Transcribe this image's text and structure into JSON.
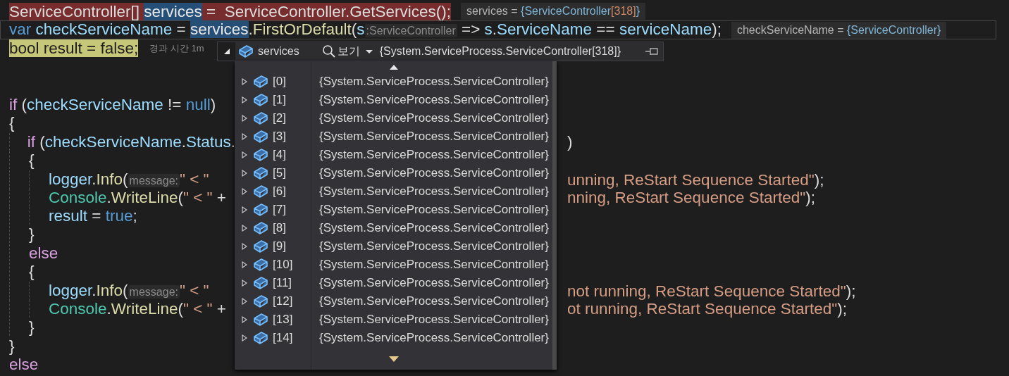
{
  "editor": {
    "lines": [
      {
        "breakpoint": true,
        "tokens": [
          {
            "text": "ServiceController[] ",
            "kind": "plain"
          },
          {
            "text": "services",
            "kind": "match"
          },
          {
            "text": " =  ServiceController.GetServices();",
            "kind": "plain"
          }
        ],
        "hint": {
          "kind": "datatip",
          "parts": [
            {
              "text": "services = ",
              "kind": "name"
            },
            {
              "text": "{ServiceController",
              "kind": "type"
            },
            {
              "text": "[318]",
              "kind": "count"
            },
            {
              "text": "}",
              "kind": "type"
            }
          ]
        }
      },
      {
        "current_line": true,
        "tokens": [
          {
            "text": "var",
            "kind": "keyword"
          },
          {
            "text": " checkServiceName",
            "kind": "variable"
          },
          {
            "text": " = ",
            "kind": "plain"
          },
          {
            "text": "services",
            "kind": "match"
          },
          {
            "text": ".",
            "kind": "plain"
          },
          {
            "text": "FirstOrDefault",
            "kind": "method"
          },
          {
            "text": "(",
            "kind": "plain"
          },
          {
            "text": "s",
            "kind": "variable"
          },
          {
            "text": ":ServiceController",
            "kind": "inlay"
          },
          {
            "text": " => ",
            "kind": "plain"
          },
          {
            "text": "s",
            "kind": "variable"
          },
          {
            "text": ".",
            "kind": "plain"
          },
          {
            "text": "ServiceName",
            "kind": "variable"
          },
          {
            "text": " == ",
            "kind": "plain"
          },
          {
            "text": "serviceName",
            "kind": "variable"
          },
          {
            "text": ");",
            "kind": "plain"
          }
        ],
        "hint": {
          "kind": "datatip",
          "parts": [
            {
              "text": "checkServiceName = ",
              "kind": "name"
            },
            {
              "text": "{ServiceController}",
              "kind": "type"
            }
          ]
        }
      },
      {
        "current_statement": true,
        "tokens": [
          {
            "text": "bool result = false;",
            "kind": "plain"
          }
        ],
        "hint": {
          "kind": "elapsed",
          "text": "경과 시간 1m"
        }
      },
      {
        "blank": true
      },
      {
        "blank": true
      },
      {
        "tokens": [
          {
            "text": "if",
            "kind": "control"
          },
          {
            "text": " (",
            "kind": "plain"
          },
          {
            "text": "checkServiceName",
            "kind": "variable"
          },
          {
            "text": " != ",
            "kind": "plain"
          },
          {
            "text": "null",
            "kind": "keyword"
          },
          {
            "text": ")",
            "kind": "plain"
          }
        ]
      },
      {
        "tokens": [
          {
            "text": "{",
            "kind": "plain"
          }
        ],
        "children": [
          {
            "tokens": [
              {
                "text": "if",
                "kind": "control"
              },
              {
                "text": " (",
                "kind": "plain"
              },
              {
                "text": "checkServiceName",
                "kind": "variable"
              },
              {
                "text": ".",
                "kind": "plain"
              },
              {
                "text": "Status",
                "kind": "variable"
              },
              {
                "text": ".",
                "kind": "plain"
              }
            ],
            "right": [
              {
                "text": ")",
                "kind": "plain"
              }
            ]
          },
          {
            "tokens": [
              {
                "text": "{",
                "kind": "plain"
              }
            ],
            "children": [
              {
                "tokens": [
                  {
                    "text": "logger",
                    "kind": "variable"
                  },
                  {
                    "text": ".",
                    "kind": "plain"
                  },
                  {
                    "text": "Info",
                    "kind": "method"
                  },
                  {
                    "text": "(",
                    "kind": "plain"
                  },
                  {
                    "text": "message:",
                    "kind": "inlay"
                  },
                  {
                    "text": "\" < \"",
                    "kind": "string"
                  }
                ],
                "right": [
                  {
                    "text": "unning, ReStart Sequence Started\"",
                    "kind": "string"
                  },
                  {
                    "text": ");",
                    "kind": "plain"
                  }
                ]
              },
              {
                "tokens": [
                  {
                    "text": "Console",
                    "kind": "type"
                  },
                  {
                    "text": ".",
                    "kind": "plain"
                  },
                  {
                    "text": "WriteLine",
                    "kind": "method"
                  },
                  {
                    "text": "(",
                    "kind": "plain"
                  },
                  {
                    "text": "\" < \"",
                    "kind": "string"
                  },
                  {
                    "text": " +",
                    "kind": "plain"
                  }
                ],
                "right": [
                  {
                    "text": "nning, ReStart Sequence Started\"",
                    "kind": "string"
                  },
                  {
                    "text": ");",
                    "kind": "plain"
                  }
                ]
              },
              {
                "tokens": [
                  {
                    "text": "result",
                    "kind": "variable"
                  },
                  {
                    "text": " = ",
                    "kind": "plain"
                  },
                  {
                    "text": "true",
                    "kind": "keyword"
                  },
                  {
                    "text": ";",
                    "kind": "plain"
                  }
                ]
              }
            ]
          },
          {
            "tokens": [
              {
                "text": "}",
                "kind": "plain"
              }
            ]
          },
          {
            "tokens": [
              {
                "text": "else",
                "kind": "control"
              }
            ]
          },
          {
            "tokens": [
              {
                "text": "{",
                "kind": "plain"
              }
            ],
            "children": [
              {
                "tokens": [
                  {
                    "text": "logger",
                    "kind": "variable"
                  },
                  {
                    "text": ".",
                    "kind": "plain"
                  },
                  {
                    "text": "Info",
                    "kind": "method"
                  },
                  {
                    "text": "(",
                    "kind": "plain"
                  },
                  {
                    "text": "message:",
                    "kind": "inlay"
                  },
                  {
                    "text": "\" < \"",
                    "kind": "string"
                  }
                ],
                "right": [
                  {
                    "text": "not running, ReStart Sequence Started\"",
                    "kind": "string"
                  },
                  {
                    "text": ");",
                    "kind": "plain"
                  }
                ]
              },
              {
                "tokens": [
                  {
                    "text": "Console",
                    "kind": "type"
                  },
                  {
                    "text": ".",
                    "kind": "plain"
                  },
                  {
                    "text": "WriteLine",
                    "kind": "method"
                  },
                  {
                    "text": "(",
                    "kind": "plain"
                  },
                  {
                    "text": "\" < \"",
                    "kind": "string"
                  },
                  {
                    "text": " +",
                    "kind": "plain"
                  }
                ],
                "right": [
                  {
                    "text": "ot running, ReStart Sequence Started\"",
                    "kind": "string"
                  },
                  {
                    "text": ");",
                    "kind": "plain"
                  }
                ]
              }
            ]
          },
          {
            "tokens": [
              {
                "text": "}",
                "kind": "plain"
              }
            ]
          }
        ]
      },
      {
        "tokens": [
          {
            "text": "}",
            "kind": "plain"
          }
        ]
      },
      {
        "tokens": [
          {
            "text": "else",
            "kind": "control"
          }
        ]
      }
    ]
  },
  "datatip_popup": {
    "expanded": true,
    "name": "services",
    "search_label": "보기",
    "value": "{System.ServiceProcess.ServiceController[318]}",
    "items": [
      {
        "name": "[0]",
        "value": "{System.ServiceProcess.ServiceController}",
        "expanded": false
      },
      {
        "name": "[1]",
        "value": "{System.ServiceProcess.ServiceController}",
        "expanded": false
      },
      {
        "name": "[2]",
        "value": "{System.ServiceProcess.ServiceController}",
        "expanded": false
      },
      {
        "name": "[3]",
        "value": "{System.ServiceProcess.ServiceController}",
        "expanded": false
      },
      {
        "name": "[4]",
        "value": "{System.ServiceProcess.ServiceController}",
        "expanded": false
      },
      {
        "name": "[5]",
        "value": "{System.ServiceProcess.ServiceController}",
        "expanded": false
      },
      {
        "name": "[6]",
        "value": "{System.ServiceProcess.ServiceController}",
        "expanded": false
      },
      {
        "name": "[7]",
        "value": "{System.ServiceProcess.ServiceController}",
        "expanded": false
      },
      {
        "name": "[8]",
        "value": "{System.ServiceProcess.ServiceController}",
        "expanded": false
      },
      {
        "name": "[9]",
        "value": "{System.ServiceProcess.ServiceController}",
        "expanded": false
      },
      {
        "name": "[10]",
        "value": "{System.ServiceProcess.ServiceController}",
        "expanded": false
      },
      {
        "name": "[11]",
        "value": "{System.ServiceProcess.ServiceController}",
        "expanded": false
      },
      {
        "name": "[12]",
        "value": "{System.ServiceProcess.ServiceController}",
        "expanded": false
      },
      {
        "name": "[13]",
        "value": "{System.ServiceProcess.ServiceController}",
        "expanded": false
      },
      {
        "name": "[14]",
        "value": "{System.ServiceProcess.ServiceController}",
        "expanded": false
      }
    ]
  }
}
